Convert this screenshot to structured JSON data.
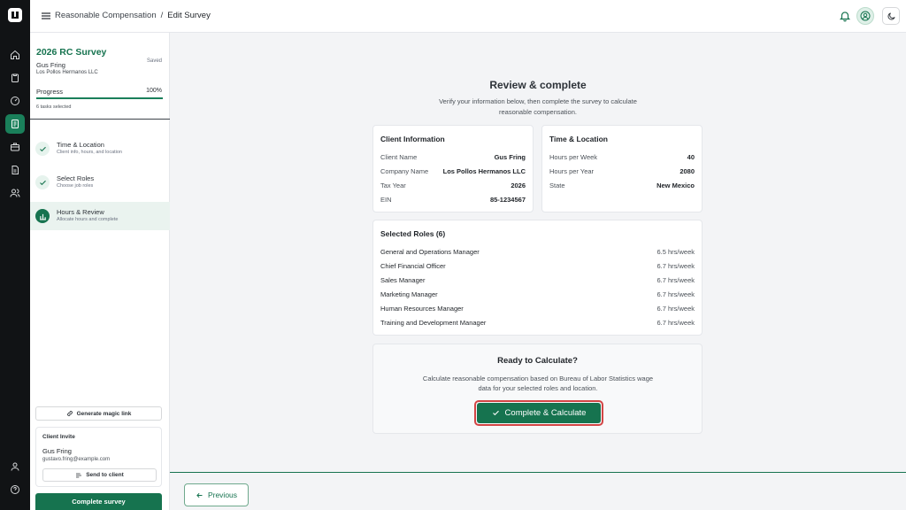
{
  "topbar": {
    "breadcrumb_parent": "Reasonable Compensation",
    "breadcrumb_separator": "/",
    "breadcrumb_current": "Edit Survey"
  },
  "sidebar": {
    "survey_title": "2026 RC Survey",
    "client_name": "Gus Fring",
    "company": "Los Pollos Hermanos LLC",
    "saved": "Saved",
    "progress_label": "Progress",
    "progress_value": "100%",
    "progress_fraction": 1.0,
    "tasks_selected": "6 tasks selected",
    "steps": [
      {
        "title": "Time & Location",
        "subtitle": "Client info, hours, and location",
        "state": "done"
      },
      {
        "title": "Select Roles",
        "subtitle": "Choose job roles",
        "state": "done"
      },
      {
        "title": "Hours & Review",
        "subtitle": "Allocate hours and complete",
        "state": "current"
      }
    ],
    "magic_link": "Generate magic link",
    "invite": {
      "heading": "Client Invite",
      "name": "Gus Fring",
      "email": "gustavo.fring@example.com",
      "send": "Send to client"
    },
    "complete_survey": "Complete survey"
  },
  "main": {
    "title": "Review & complete",
    "subtitle": "Verify your information below, then complete the survey to calculate reasonable compensation.",
    "client_info": {
      "heading": "Client Information",
      "rows": [
        {
          "label": "Client Name",
          "value": "Gus Fring"
        },
        {
          "label": "Company Name",
          "value": "Los Pollos Hermanos LLC"
        },
        {
          "label": "Tax Year",
          "value": "2026"
        },
        {
          "label": "EIN",
          "value": "85-1234567"
        }
      ]
    },
    "time_location": {
      "heading": "Time & Location",
      "rows": [
        {
          "label": "Hours per Week",
          "value": "40"
        },
        {
          "label": "Hours per Year",
          "value": "2080"
        },
        {
          "label": "State",
          "value": "New Mexico"
        }
      ]
    },
    "roles": {
      "heading": "Selected Roles (6)",
      "rows": [
        {
          "label": "General and Operations Manager",
          "value": "6.5 hrs/week"
        },
        {
          "label": "Chief Financial Officer",
          "value": "6.7 hrs/week"
        },
        {
          "label": "Sales Manager",
          "value": "6.7 hrs/week"
        },
        {
          "label": "Marketing Manager",
          "value": "6.7 hrs/week"
        },
        {
          "label": "Human Resources Manager",
          "value": "6.7 hrs/week"
        },
        {
          "label": "Training and Development Manager",
          "value": "6.7 hrs/week"
        }
      ]
    },
    "ready": {
      "heading": "Ready to Calculate?",
      "subtitle": "Calculate reasonable compensation based on Bureau of Labor Statistics wage data for your selected roles and location.",
      "button": "Complete & Calculate"
    }
  },
  "footer": {
    "previous": "Previous"
  },
  "colors": {
    "brand_green": "#16734f",
    "highlight_red": "#d24545",
    "rail_bg": "#111315"
  }
}
